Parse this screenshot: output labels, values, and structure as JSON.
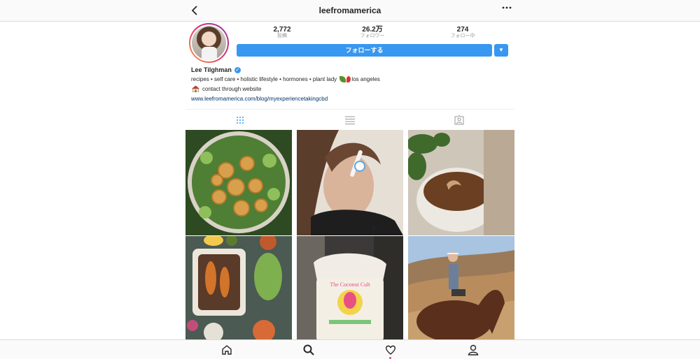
{
  "header": {
    "username": "leefromamerica",
    "back_icon": "back-arrow-icon",
    "more_icon": "more-horizontal-icon"
  },
  "profile": {
    "stats": [
      {
        "value": "2,772",
        "label": "投稿"
      },
      {
        "value": "26.2万",
        "label": "フォロワー"
      },
      {
        "value": "274",
        "label": "フォロー中"
      }
    ],
    "follow_label": "フォローする",
    "dropdown_glyph": "▼",
    "name": "Lee Tilghman",
    "verified_glyph": "✓",
    "bio_line1_text": "recipes • self care • holistic lifestyle • hormones • plant lady",
    "bio_line1_suffix": "los angeles",
    "bio_line2_text": "contact through website",
    "website": "www.leefromamerica.com/blog/myexperiencetakingcbd"
  },
  "tabs": [
    {
      "name": "grid",
      "icon": "grid-icon",
      "active": true
    },
    {
      "name": "list",
      "icon": "list-icon",
      "active": false
    },
    {
      "name": "tagged",
      "icon": "tagged-icon",
      "active": false
    }
  ],
  "posts": [
    {
      "subject": "salad with waffle fries",
      "colors": [
        "#3e6b2a",
        "#d9a24f",
        "#6f8f3a"
      ]
    },
    {
      "subject": "woman holding spoon",
      "colors": [
        "#c9a48a",
        "#2b2b2b",
        "#e9e3dc"
      ]
    },
    {
      "subject": "mug of cocoa with plant",
      "colors": [
        "#5e3b24",
        "#e8e4df",
        "#3f6a2c"
      ]
    },
    {
      "subject": "roasted vegetables tray",
      "colors": [
        "#b86a2a",
        "#3f4a3c",
        "#8cb35a"
      ]
    },
    {
      "subject": "coconut jar",
      "colors": [
        "#d7cfc0",
        "#e84f83",
        "#f2e6d0"
      ]
    },
    {
      "subject": "woman on horse",
      "colors": [
        "#7a4b2e",
        "#a3c3e3",
        "#b98a5e"
      ]
    }
  ],
  "bottom_nav": [
    {
      "name": "home",
      "icon": "home-icon"
    },
    {
      "name": "search",
      "icon": "search-icon"
    },
    {
      "name": "activity",
      "icon": "heart-icon"
    },
    {
      "name": "profile",
      "icon": "profile-icon"
    }
  ],
  "colors": {
    "accent": "#3897f0",
    "link": "#003569",
    "notification": "#ed4956"
  }
}
